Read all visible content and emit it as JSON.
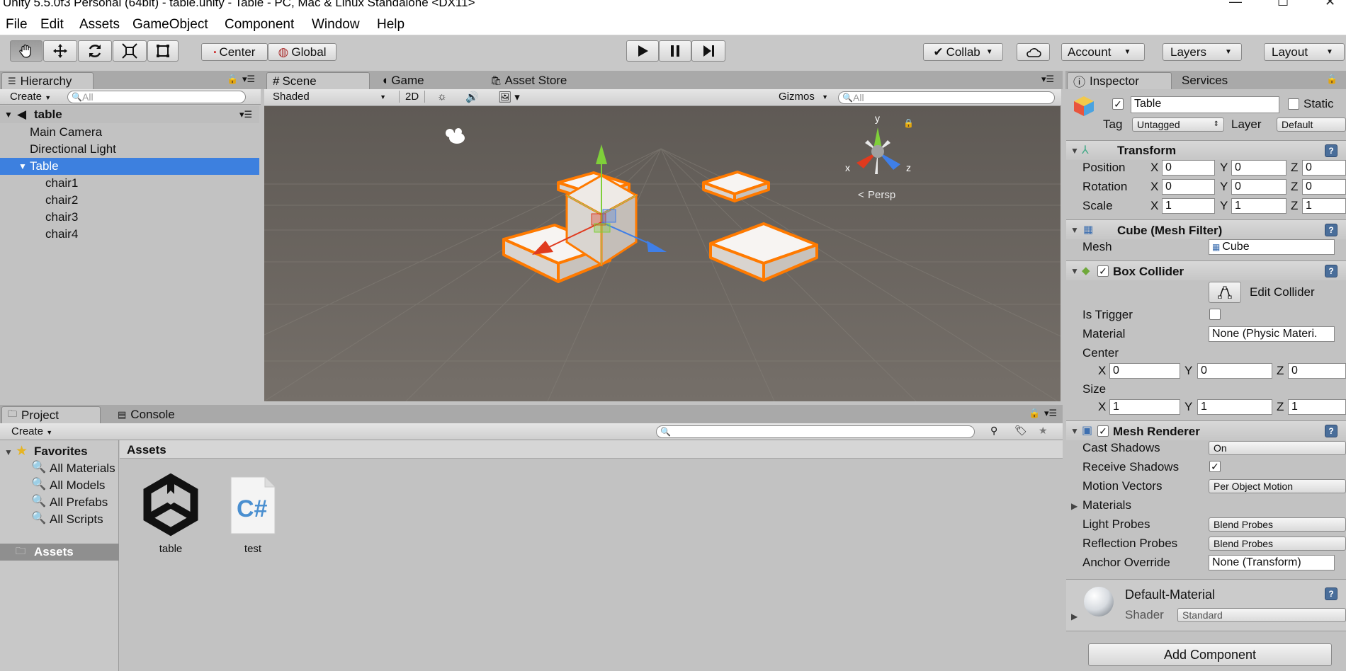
{
  "window": {
    "title": "Unity 5.5.0f3 Personal (64bit) - table.unity - Table - PC, Mac & Linux Standalone <DX11>",
    "minimize_glyph": "—",
    "maximize_glyph": "☐",
    "close_glyph": "✕"
  },
  "menu": [
    "File",
    "Edit",
    "Assets",
    "GameObject",
    "Component",
    "Window",
    "Help"
  ],
  "toolbar": {
    "pivot_label": "Center",
    "space_label": "Global",
    "collab_label": "Collab",
    "account_label": "Account",
    "layers_label": "Layers",
    "layout_label": "Layout",
    "icons": [
      "hand-icon",
      "move-icon",
      "rotate-icon",
      "scale-icon",
      "rect-tool-icon",
      "play-icon",
      "pause-icon",
      "step-icon",
      "cloud-icon",
      "check-icon"
    ]
  },
  "hierarchy": {
    "tab_label": "Hierarchy",
    "create_label": "Create",
    "search_placeholder": "All",
    "scene_name": "table",
    "items": [
      {
        "label": "Main Camera"
      },
      {
        "label": "Directional Light"
      },
      {
        "label": "Table",
        "selected": true
      },
      {
        "label": "chair1"
      },
      {
        "label": "chair2"
      },
      {
        "label": "chair3"
      },
      {
        "label": "chair4"
      }
    ]
  },
  "scene": {
    "tabs": [
      "Scene",
      "Game",
      "Asset Store"
    ],
    "shading_mode": "Shaded",
    "mode_2d": "2D",
    "gizmos_label": "Gizmos",
    "search_placeholder": "All",
    "persp_label": "Persp",
    "axis_labels": {
      "x": "x",
      "y": "y",
      "z": "z"
    }
  },
  "inspector": {
    "tabs": [
      "Inspector",
      "Services"
    ],
    "object_name": "Table",
    "static_label": "Static",
    "tag_label": "Tag",
    "tag_value": "Untagged",
    "layer_label": "Layer",
    "layer_value": "Default",
    "transform": {
      "title": "Transform",
      "position_label": "Position",
      "rotation_label": "Rotation",
      "scale_label": "Scale",
      "position": [
        "0",
        "0",
        "0"
      ],
      "rotation": [
        "0",
        "0",
        "0"
      ],
      "scale": [
        "1",
        "1",
        "1"
      ]
    },
    "mesh_filter": {
      "title": "Cube (Mesh Filter)",
      "mesh_label": "Mesh",
      "mesh_value": "Cube"
    },
    "box_collider": {
      "title": "Box Collider",
      "edit_label": "Edit Collider",
      "is_trigger_label": "Is Trigger",
      "material_label": "Material",
      "material_value": "None (Physic Materi.",
      "center_label": "Center",
      "size_label": "Size",
      "center": [
        "0",
        "0",
        "0"
      ],
      "size": [
        "1",
        "1",
        "1"
      ]
    },
    "mesh_renderer": {
      "title": "Mesh Renderer",
      "cast_shadows_label": "Cast Shadows",
      "cast_shadows_value": "On",
      "receive_shadows_label": "Receive Shadows",
      "motion_vectors_label": "Motion Vectors",
      "motion_vectors_value": "Per Object Motion",
      "materials_label": "Materials",
      "light_probes_label": "Light Probes",
      "light_probes_value": "Blend Probes",
      "reflection_probes_label": "Reflection Probes",
      "reflection_probes_value": "Blend Probes",
      "anchor_override_label": "Anchor Override",
      "anchor_override_value": "None (Transform)"
    },
    "material": {
      "name": "Default-Material",
      "shader_label": "Shader",
      "shader_value": "Standard"
    },
    "add_component_label": "Add Component",
    "axes": [
      "X",
      "Y",
      "Z"
    ]
  },
  "project": {
    "tabs": [
      "Project",
      "Console"
    ],
    "create_label": "Create",
    "favorites_label": "Favorites",
    "favorites": [
      "All Materials",
      "All Models",
      "All Prefabs",
      "All Scripts"
    ],
    "assets_root": "Assets",
    "breadcrumb": "Assets",
    "assets": [
      {
        "name": "table",
        "icon": "unity-scene-icon"
      },
      {
        "name": "test",
        "icon": "csharp-script-icon"
      }
    ],
    "cs_glyph": "C#"
  },
  "colors": {
    "selection": "#3d80df",
    "scene_bg": "#6f6a64",
    "outline": "#ff7a00"
  }
}
